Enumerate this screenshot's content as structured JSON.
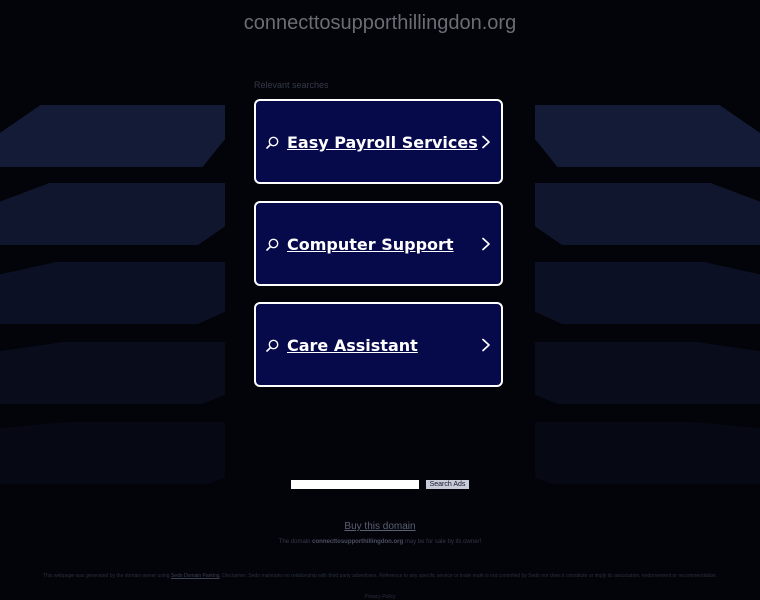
{
  "header": {
    "domain_title": "connecttosupporthillingdon.org"
  },
  "relevant": {
    "label": "Relevant searches",
    "items": [
      {
        "label": "Easy Payroll Services"
      },
      {
        "label": "Computer Support"
      },
      {
        "label": "Care Assistant"
      }
    ]
  },
  "search": {
    "input_value": "",
    "button_label": "Search Ads"
  },
  "footer": {
    "buy_label": "Buy this domain",
    "sale_prefix": "The domain",
    "sale_domain": "connecttosupporthillingdon.org",
    "sale_suffix": "may be for sale by its owner!",
    "disclaimer_start": "This webpage was generated by the domain owner using",
    "disclaimer_link": "Sedo Domain Parking",
    "disclaimer_end": ". Disclaimer: Sedo maintains no relationship with third party advertisers. Reference to any specific service or trade mark is not controlled by Sedo nor does it constitute or imply its association, endorsement or recommendation.",
    "privacy_label": "Privacy Policy"
  },
  "colors": {
    "background": "#020409",
    "card_bg": "#06094a",
    "card_border": "#ffffff",
    "bg_shape": "#151c3a"
  },
  "icons": {
    "card_icon": "search-icon",
    "card_chevron": "chevron-right-icon"
  }
}
